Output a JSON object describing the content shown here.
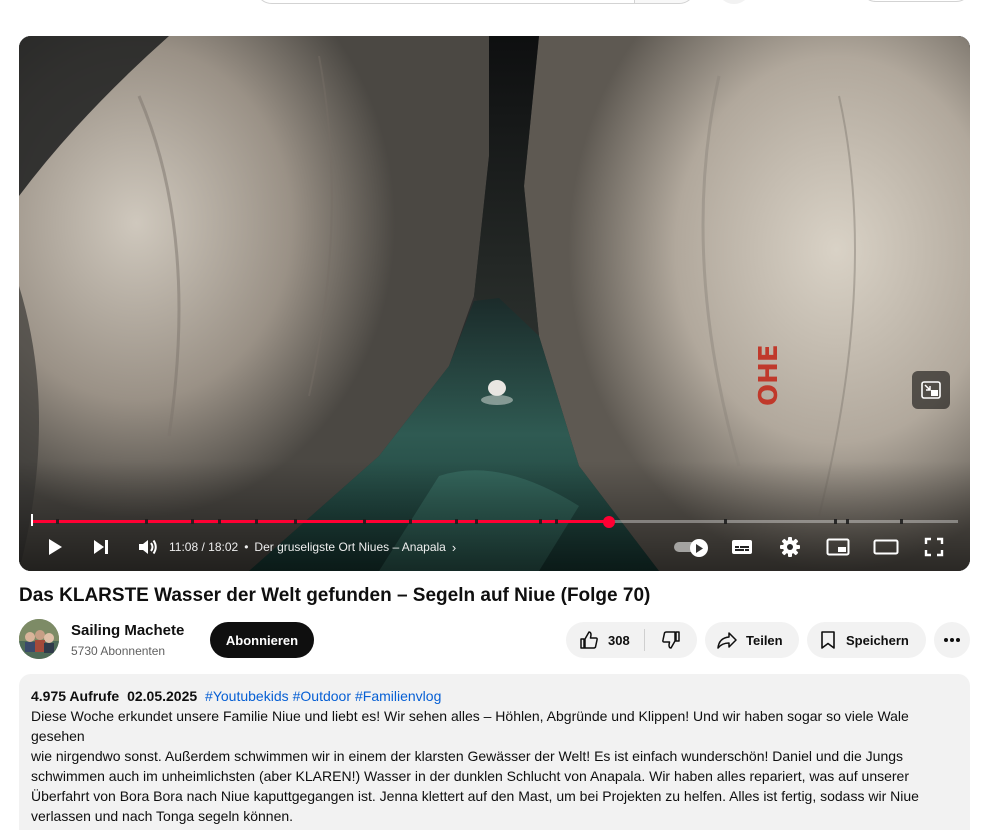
{
  "video": {
    "title": "Das KLARSTE Wasser der Welt gefunden – Segeln auf Niue (Folge 70)",
    "progress_fraction": 0.623
  },
  "player": {
    "time_current": "11:08",
    "time_total": "18:02",
    "time_separator": "/",
    "chapter_title": "Der gruseligste Ort Niues – Anapala",
    "chapter_bullet": "•",
    "chapter_chevron": "›",
    "overlay_text": "OHE",
    "colors": {
      "progress": "#ff0033",
      "subscribe": "#0f0f0f",
      "hashtag": "#065fd4"
    }
  },
  "channel": {
    "name": "Sailing Machete",
    "subscribers": "5730 Abonnenten",
    "subscribe_label": "Abonnieren"
  },
  "actions": {
    "like_count": "308",
    "share_label": "Teilen",
    "save_label": "Speichern"
  },
  "description": {
    "views": "4.975 Aufrufe",
    "date": "02.05.2025",
    "hashtags": [
      "#Youtubekids",
      "#Outdoor",
      "#Familienvlog"
    ],
    "lines": [
      "Diese Woche erkundet unsere Familie Niue und liebt es! Wir sehen alles – Höhlen, Abgründe und Klippen! Und wir haben sogar so viele Wale gesehen",
      "wie nirgendwo sonst. Außerdem schwimmen wir in einem der klarsten Gewässer der Welt! Es ist einfach wunderschön! Daniel und die Jungs",
      "schwimmen auch im unheimlichsten (aber KLAREN!) Wasser in der dunklen Schlucht von Anapala. Wir haben alles repariert, was auf unserer",
      "Überfahrt von Bora Bora nach Niue kaputtgegangen ist. Jenna klettert auf den Mast, um bei Projekten zu helfen. Alles ist fertig, sodass wir Niue",
      "verlassen und nach Tonga segeln können."
    ]
  },
  "icons": {
    "play": "play-icon",
    "next": "next-icon",
    "volume": "volume-icon",
    "autoplay": "autoplay-toggle",
    "subtitles": "subtitles-icon",
    "settings": "gear-icon",
    "miniplayer": "miniplayer-icon",
    "theater": "theater-icon",
    "fullscreen": "fullscreen-icon",
    "like": "thumbs-up-icon",
    "dislike": "thumbs-down-icon",
    "share": "share-icon",
    "save": "bookmark-icon",
    "more": "more-icon"
  }
}
